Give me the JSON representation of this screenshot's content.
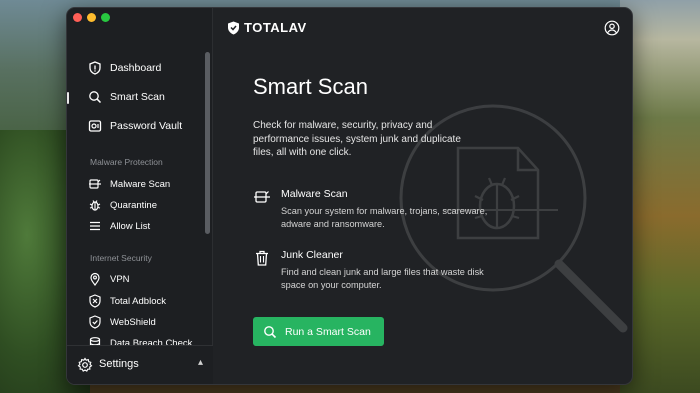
{
  "app": {
    "brand": "TOTALAV"
  },
  "sidebar": {
    "top_items": [
      {
        "label": "Dashboard",
        "icon": "shield-icon"
      },
      {
        "label": "Smart Scan",
        "icon": "search-icon"
      },
      {
        "label": "Password Vault",
        "icon": "vault-icon"
      }
    ],
    "sections": [
      {
        "label": "Malware Protection",
        "items": [
          {
            "label": "Malware Scan",
            "icon": "scanner-icon"
          },
          {
            "label": "Quarantine",
            "icon": "bug-icon"
          },
          {
            "label": "Allow List",
            "icon": "list-icon"
          }
        ]
      },
      {
        "label": "Internet Security",
        "items": [
          {
            "label": "VPN",
            "icon": "location-pin-icon"
          },
          {
            "label": "Total Adblock",
            "icon": "adblock-shield-icon"
          },
          {
            "label": "WebShield",
            "icon": "check-shield-icon"
          },
          {
            "label": "Data Breach Check",
            "icon": "database-icon"
          }
        ]
      }
    ],
    "settings_label": "Settings"
  },
  "main": {
    "title": "Smart Scan",
    "description": "Check for malware, security, privacy and performance issues, system junk and duplicate files, all with one click.",
    "features": [
      {
        "title": "Malware Scan",
        "desc": "Scan your system for malware, trojans, scareware, adware and ransomware.",
        "icon": "scanner-icon"
      },
      {
        "title": "Junk Cleaner",
        "desc": "Find and clean junk and large files that waste disk space on your computer.",
        "icon": "trash-icon"
      }
    ],
    "cta_label": "Run a Smart Scan"
  },
  "colors": {
    "accent": "#27b461",
    "window_bg": "#202225",
    "sidebar_bg": "#1d1f22"
  }
}
